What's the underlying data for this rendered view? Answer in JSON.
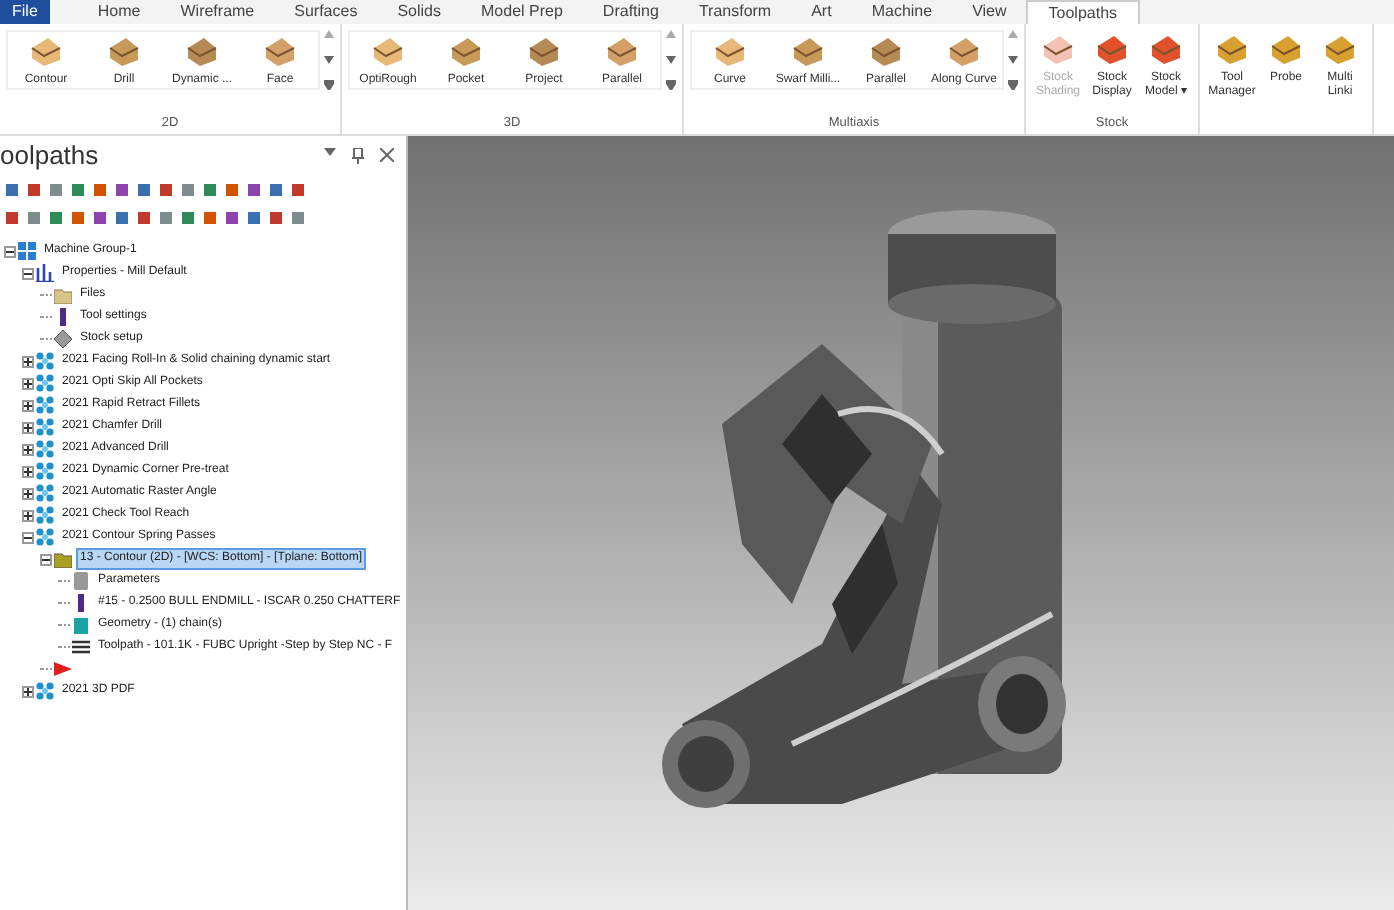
{
  "tabs": [
    {
      "label": "File",
      "selected": false,
      "kind": "file"
    },
    {
      "label": "Home",
      "selected": false,
      "kind": "tab"
    },
    {
      "label": "Wireframe",
      "selected": false,
      "kind": "tab"
    },
    {
      "label": "Surfaces",
      "selected": false,
      "kind": "tab"
    },
    {
      "label": "Solids",
      "selected": false,
      "kind": "tab"
    },
    {
      "label": "Model Prep",
      "selected": false,
      "kind": "tab"
    },
    {
      "label": "Drafting",
      "selected": false,
      "kind": "tab"
    },
    {
      "label": "Transform",
      "selected": false,
      "kind": "tab"
    },
    {
      "label": "Art",
      "selected": false,
      "kind": "tab"
    },
    {
      "label": "Machine",
      "selected": false,
      "kind": "tab"
    },
    {
      "label": "View",
      "selected": false,
      "kind": "tab"
    },
    {
      "label": "Toolpaths",
      "selected": true,
      "kind": "tab"
    }
  ],
  "ribbon_groups": [
    {
      "label": "2D",
      "kind": "gallery",
      "buttons": [
        {
          "label": "Contour",
          "disabled": false
        },
        {
          "label": "Drill",
          "disabled": false
        },
        {
          "label": "Dynamic ...",
          "disabled": false
        },
        {
          "label": "Face",
          "disabled": false
        }
      ]
    },
    {
      "label": "3D",
      "kind": "gallery",
      "buttons": [
        {
          "label": "OptiRough",
          "disabled": false
        },
        {
          "label": "Pocket",
          "disabled": false
        },
        {
          "label": "Project",
          "disabled": false
        },
        {
          "label": "Parallel",
          "disabled": false
        }
      ]
    },
    {
      "label": "Multiaxis",
      "kind": "gallery",
      "buttons": [
        {
          "label": "Curve",
          "disabled": false
        },
        {
          "label": "Swarf Milli...",
          "disabled": false
        },
        {
          "label": "Parallel",
          "disabled": false
        },
        {
          "label": "Along Curve",
          "disabled": false
        }
      ]
    },
    {
      "label": "Stock",
      "kind": "plain",
      "buttons": [
        {
          "label": "Stock Shading",
          "disabled": true
        },
        {
          "label": "Stock Display",
          "disabled": false
        },
        {
          "label": "Stock Model ▾",
          "disabled": false
        }
      ]
    },
    {
      "kind": "plain",
      "buttons": [
        {
          "label": "Tool Manager",
          "disabled": false
        },
        {
          "label": "Probe",
          "disabled": false
        },
        {
          "label": "Multi Linki",
          "disabled": false
        }
      ]
    }
  ],
  "panel": {
    "title": "oolpaths",
    "tree": [
      {
        "label": "Machine Group-1",
        "kind": "machine",
        "expanded": true,
        "selected": false,
        "children": [
          {
            "label": "Properties - Mill Default",
            "kind": "properties",
            "expanded": true,
            "selected": false,
            "children": [
              {
                "label": "Files",
                "kind": "folder",
                "selected": false
              },
              {
                "label": "Tool settings",
                "kind": "tool",
                "selected": false
              },
              {
                "label": "Stock setup",
                "kind": "stock",
                "selected": false
              }
            ]
          },
          {
            "label": "2021 Facing Roll-In & Solid chaining dynamic start",
            "kind": "group",
            "expanded": false,
            "selected": false
          },
          {
            "label": "2021 Opti Skip All Pockets",
            "kind": "group",
            "expanded": false,
            "selected": false
          },
          {
            "label": "2021 Rapid Retract Fillets",
            "kind": "group",
            "expanded": false,
            "selected": false
          },
          {
            "label": "2021 Chamfer Drill",
            "kind": "group",
            "expanded": false,
            "selected": false
          },
          {
            "label": "2021 Advanced Drill",
            "kind": "group",
            "expanded": false,
            "selected": false
          },
          {
            "label": "2021 Dynamic Corner Pre-treat",
            "kind": "group",
            "expanded": false,
            "selected": false
          },
          {
            "label": "2021 Automatic Raster Angle",
            "kind": "group",
            "expanded": false,
            "selected": false
          },
          {
            "label": "2021 Check Tool Reach",
            "kind": "group",
            "expanded": false,
            "selected": false
          },
          {
            "label": "2021 Contour Spring Passes",
            "kind": "group",
            "expanded": true,
            "selected": false,
            "children": [
              {
                "label": "13 - Contour (2D) - [WCS: Bottom] - [Tplane: Bottom]",
                "kind": "operation",
                "expanded": true,
                "selected": true,
                "children": [
                  {
                    "label": "Parameters",
                    "kind": "parameters",
                    "selected": false
                  },
                  {
                    "label": "#15 - 0.2500 BULL ENDMILL - ISCAR 0.250 CHATTERF",
                    "kind": "tool",
                    "selected": false
                  },
                  {
                    "label": "Geometry - (1) chain(s)",
                    "kind": "geometry",
                    "selected": false
                  },
                  {
                    "label": "Toolpath - 101.1K - FUBC Upright -Step by Step NC - F",
                    "kind": "toolpath",
                    "selected": false
                  }
                ]
              },
              {
                "kind": "insert"
              }
            ]
          },
          {
            "label": "2021 3D PDF",
            "kind": "group",
            "expanded": false,
            "selected": false
          }
        ]
      }
    ]
  }
}
